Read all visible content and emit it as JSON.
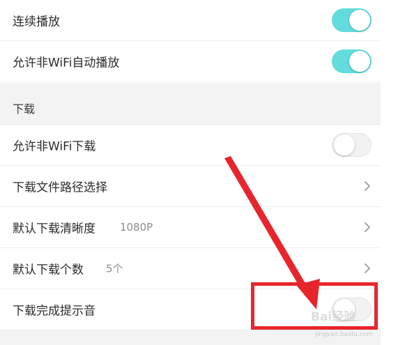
{
  "settings": {
    "continuous_play": {
      "label": "连续播放",
      "toggle": "on"
    },
    "non_wifi_autoplay": {
      "label": "允许非WiFi自动播放",
      "toggle": "on"
    },
    "download_section": {
      "title": "下载"
    },
    "non_wifi_download": {
      "label": "允许非WiFi下载",
      "toggle": "off"
    },
    "download_path": {
      "label": "下载文件路径选择"
    },
    "default_quality": {
      "label": "默认下载清晰度",
      "value": "1080P"
    },
    "default_count": {
      "label": "默认下载个数",
      "value": "5个"
    },
    "download_complete_sound": {
      "label": "下载完成提示音",
      "toggle": "off"
    }
  },
  "colors": {
    "toggle_on": "#62dcdc",
    "toggle_off": "#f2f2f2",
    "annotation_red": "#e6262c"
  },
  "icons": {
    "chevron": "chevron-right-icon",
    "arrow": "red-arrow-annotation"
  },
  "watermark": {
    "text": "Bai经验",
    "subtext": "jingyan.baidu.com"
  }
}
